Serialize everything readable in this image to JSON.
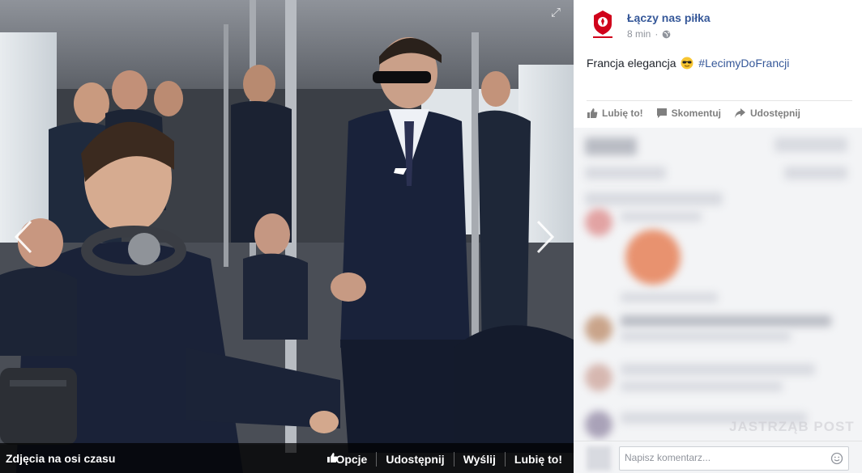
{
  "photo": {
    "album_label": "Zdjęcia na osi czasu",
    "options_label": "Opcje",
    "share_label": "Udostępnij",
    "send_label": "Wyślij",
    "like_label": "Lubię to!"
  },
  "post": {
    "page_name": "Łączy nas piłka",
    "time": "8 min",
    "privacy_icon": "globe-icon",
    "text": "Francja elegancja",
    "emoji": "sunglasses-emoji",
    "hashtag": "#LecimyDoFrancji",
    "actions": {
      "like": "Lubię to!",
      "comment": "Skomentuj",
      "share": "Udostępnij"
    }
  },
  "comment_box": {
    "placeholder": "Napisz komentarz..."
  },
  "watermark": "JASTRZĄB POST",
  "colors": {
    "link": "#365899",
    "accent_red": "#d0021b"
  }
}
